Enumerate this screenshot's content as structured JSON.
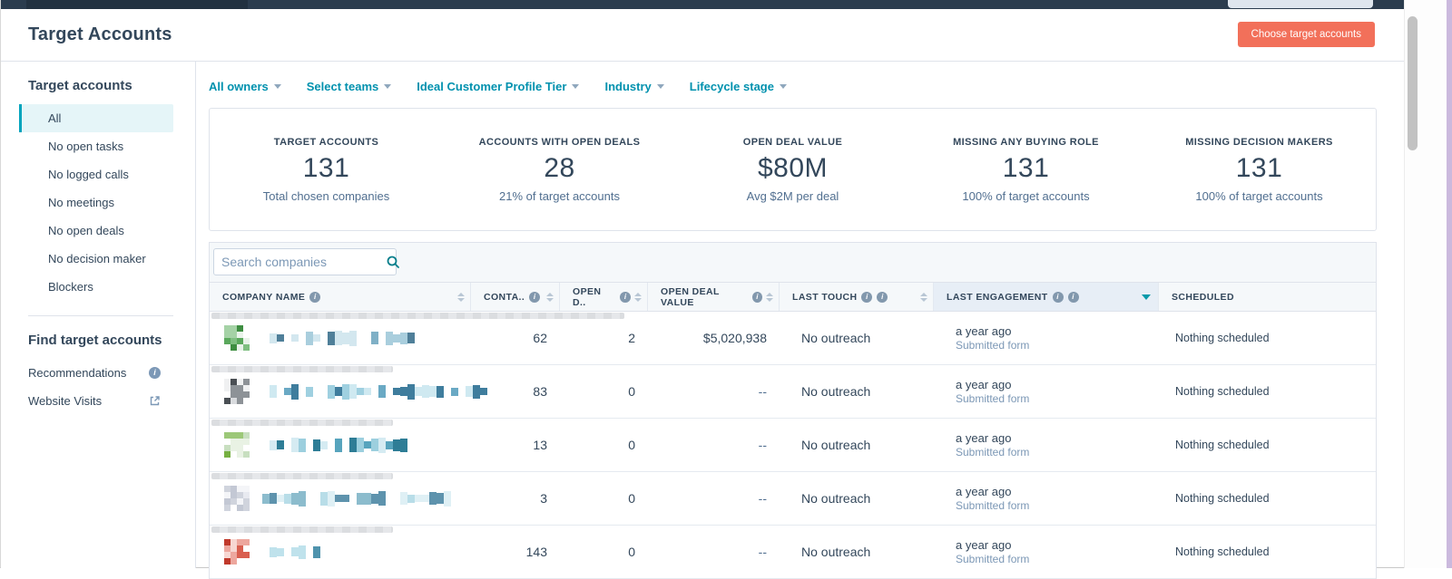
{
  "header": {
    "title": "Target Accounts",
    "cta_label": "Choose target accounts"
  },
  "sidebar": {
    "section1_title": "Target accounts",
    "items": [
      "All",
      "No open tasks",
      "No logged calls",
      "No meetings",
      "No open deals",
      "No decision maker",
      "Blockers"
    ],
    "active_item": "All",
    "section2_title": "Find target accounts",
    "links": [
      {
        "label": "Recommendations",
        "icon": "info-icon"
      },
      {
        "label": "Website Visits",
        "icon": "external-link-icon"
      }
    ]
  },
  "filters": [
    {
      "label": "All owners"
    },
    {
      "label": "Select teams"
    },
    {
      "label": "Ideal Customer Profile Tier"
    },
    {
      "label": "Industry"
    },
    {
      "label": "Lifecycle stage"
    }
  ],
  "stats": [
    {
      "label": "TARGET ACCOUNTS",
      "value": "131",
      "caption": "Total chosen companies"
    },
    {
      "label": "ACCOUNTS WITH OPEN DEALS",
      "value": "28",
      "caption": "21% of target accounts"
    },
    {
      "label": "OPEN DEAL VALUE",
      "value": "$80M",
      "caption": "Avg $2M per deal"
    },
    {
      "label": "MISSING ANY BUYING ROLE",
      "value": "131",
      "caption": "100% of target accounts"
    },
    {
      "label": "MISSING DECISION MAKERS",
      "value": "131",
      "caption": "100% of target accounts"
    }
  ],
  "table": {
    "search_placeholder": "Search companies",
    "columns": [
      {
        "label": "COMPANY NAME",
        "info_icons": 1,
        "sortable": true
      },
      {
        "label": "CONTA..",
        "info_icons": 1,
        "sortable": true
      },
      {
        "label": "OPEN D..",
        "info_icons": 1,
        "sortable": true
      },
      {
        "label": "OPEN DEAL VALUE",
        "info_icons": 1,
        "sortable": true
      },
      {
        "label": "LAST TOUCH",
        "info_icons": 2,
        "sortable": true
      },
      {
        "label": "LAST ENGAGEMENT",
        "info_icons": 2,
        "sorted": "desc"
      },
      {
        "label": "SCHEDULED",
        "info_icons": 0
      }
    ],
    "rows": [
      {
        "company_redacted": true,
        "contacts": "62",
        "open_deals": "2",
        "open_deal_value": "$5,020,938",
        "last_touch": "No outreach",
        "last_engagement_time": "a year ago",
        "last_engagement_detail": "Submitted form",
        "scheduled": "Nothing scheduled",
        "logo_palette": [
          "#3e8e41",
          "#5aa85c",
          "#7fbf81",
          "#a5d2a6",
          "#e9f3ea"
        ],
        "name_palette": [
          "#4f7f99",
          "#7fb0c6",
          "#a9cedd",
          "#d3e7ef"
        ],
        "name_width": 170,
        "strip_width": 455
      },
      {
        "company_redacted": true,
        "contacts": "83",
        "open_deals": "0",
        "open_deal_value": "--",
        "last_touch": "No outreach",
        "last_engagement_time": "a year ago",
        "last_engagement_detail": "Submitted form",
        "scheduled": "Nothing scheduled",
        "logo_palette": [
          "#4a4f54",
          "#8d9297",
          "#d9dbde",
          "#f0f1f2"
        ],
        "name_palette": [
          "#3f7d9d",
          "#6aa9c4",
          "#9fd0e0",
          "#cfe9f1"
        ],
        "name_width": 250,
        "strip_width": 200
      },
      {
        "company_redacted": true,
        "contacts": "13",
        "open_deals": "0",
        "open_deal_value": "--",
        "last_touch": "No outreach",
        "last_engagement_time": "a year ago",
        "last_engagement_detail": "Submitted form",
        "scheduled": "Nothing scheduled",
        "logo_palette": [
          "#76b041",
          "#9cc878",
          "#c8dfc0",
          "#e9f2e4"
        ],
        "name_palette": [
          "#2e7d96",
          "#57a4bd",
          "#9ccfde",
          "#d5ebf2"
        ],
        "name_width": 165,
        "strip_width": 200
      },
      {
        "company_redacted": true,
        "contacts": "3",
        "open_deals": "0",
        "open_deal_value": "--",
        "last_touch": "No outreach",
        "last_engagement_time": "a year ago",
        "last_engagement_detail": "Submitted form",
        "scheduled": "Nothing scheduled",
        "logo_palette": [
          "#e8eaf0",
          "#d0d4dd",
          "#c3c8d4",
          "#f4f5f8"
        ],
        "name_palette": [
          "#5e93ad",
          "#8cbccd",
          "#b8dde8",
          "#dff0f5"
        ],
        "name_width": 225,
        "strip_width": 200
      },
      {
        "company_redacted": true,
        "contacts": "143",
        "open_deals": "0",
        "open_deal_value": "--",
        "last_touch": "No outreach",
        "last_engagement_time": "a year ago",
        "last_engagement_detail": "Submitted form",
        "scheduled": "Nothing scheduled",
        "logo_palette": [
          "#c0392b",
          "#d95f50",
          "#eda79e",
          "#f7d7d2"
        ],
        "name_palette": [
          "#4f93ad",
          "#85c3d6",
          "#bfe2ec"
        ],
        "name_width": 78,
        "strip_width": 200
      }
    ]
  },
  "colors": {
    "topnav": "#2b3c4e",
    "accent_orange": "#f2705a",
    "link_teal": "#0091ae",
    "active_teal": "#00a4bd",
    "text": "#33475b",
    "secondary_text": "#516f90",
    "muted_text": "#7c98b6",
    "border": "#dfe3eb",
    "table_header_bg": "#f5f8fa",
    "sorted_column_bg": "#e7eef6",
    "active_item_bg": "#e5f5f8"
  }
}
